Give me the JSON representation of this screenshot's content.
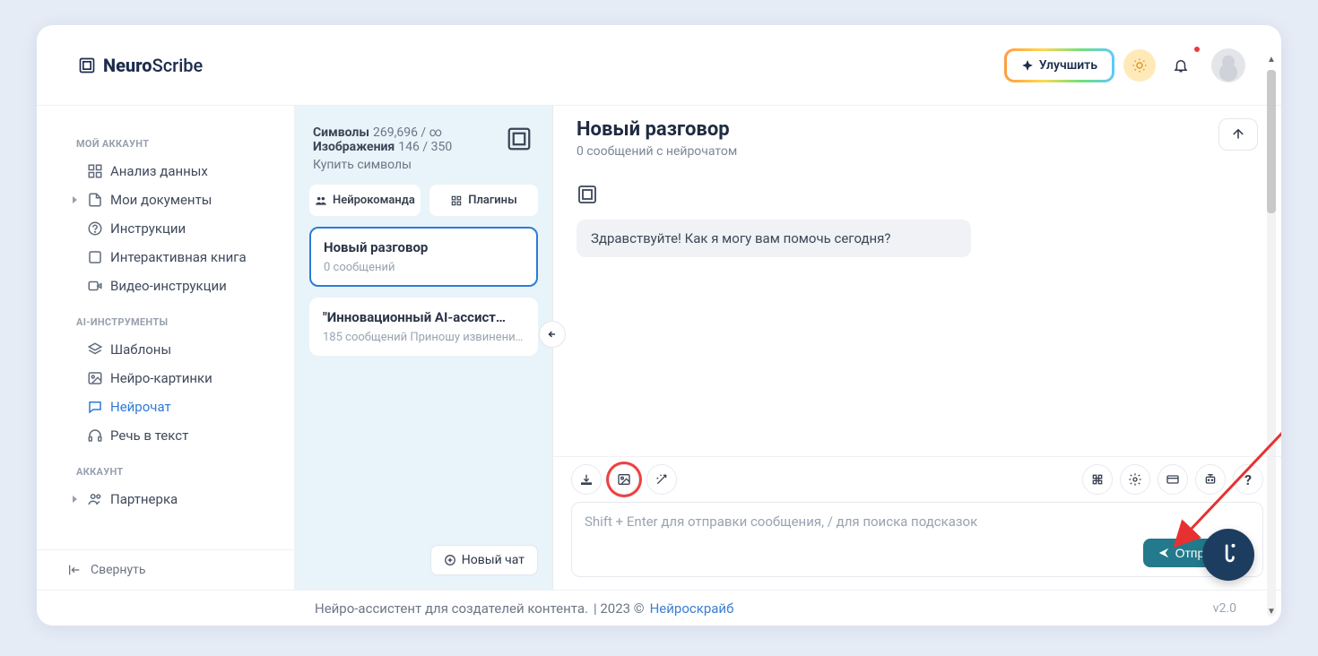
{
  "brand": {
    "name1": "Neuro",
    "name2": "Scribe"
  },
  "header": {
    "upgrade": "Улучшить"
  },
  "sidebar": {
    "sections": {
      "account": "МОЙ АККАУНТ",
      "tools": "AI-ИНСТРУМЕНТЫ",
      "acct": "АККАУНТ"
    },
    "items": {
      "analytics": "Анализ данных",
      "docs": "Мои документы",
      "instructions": "Инструкции",
      "book": "Интерактивная книга",
      "video": "Видео-инструкции",
      "templates": "Шаблоны",
      "images": "Нейро-картинки",
      "chat": "Нейрочат",
      "speech": "Речь в текст",
      "partner": "Партнерка"
    },
    "collapse": "Свернуть"
  },
  "meta": {
    "symbols_label": "Символы",
    "symbols_value": "269,696 / ∞",
    "images_label": "Изображения",
    "images_value": "146 / 350",
    "buy": "Купить символы"
  },
  "buttons": {
    "team": "Нейрокоманда",
    "plugins": "Плагины",
    "newchat": "Новый чат",
    "send": "Отправить"
  },
  "conversations": [
    {
      "title": "Новый разговор",
      "sub": "0 сообщений"
    },
    {
      "title": "\"Инновационный AI-ассист…",
      "sub": "185 сообщений Приношу извинения …"
    }
  ],
  "chat": {
    "title": "Новый разговор",
    "sub": "0 сообщений с нейрочатом",
    "greeting": "Здравствуйте! Как я могу вам помочь сегодня?",
    "placeholder": "Shift + Enter для отправки сообщения, / для поиска подсказок",
    "help": "?"
  },
  "footer": {
    "text": "Нейро-ассистент для создателей контента.",
    "year": "| 2023 ©",
    "brand": "Нейроскрайб",
    "version": "v2.0"
  }
}
